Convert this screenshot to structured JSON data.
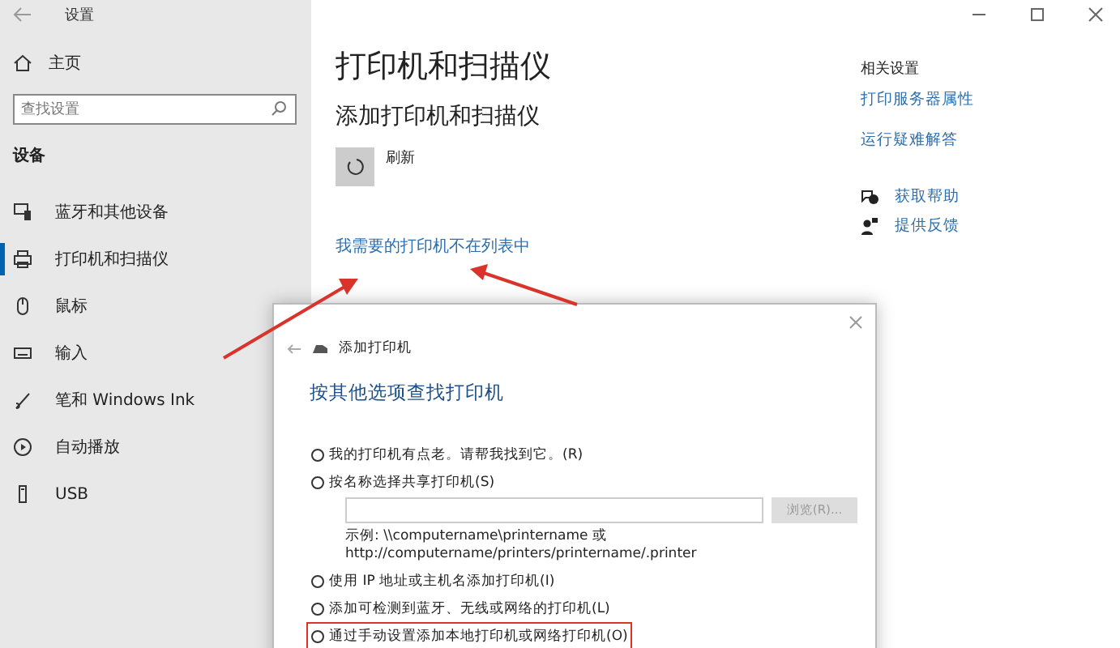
{
  "window": {
    "title": "设置"
  },
  "sidebar": {
    "home": "主页",
    "search": {
      "placeholder": "查找设置"
    },
    "section": "设备",
    "items": [
      {
        "kind": "devices",
        "label": "蓝牙和其他设备",
        "selected": false
      },
      {
        "kind": "printer",
        "label": "打印机和扫描仪",
        "selected": true
      },
      {
        "kind": "mouse",
        "label": "鼠标",
        "selected": false
      },
      {
        "kind": "keyboard",
        "label": "输入",
        "selected": false
      },
      {
        "kind": "pen",
        "label": "笔和 Windows Ink",
        "selected": false
      },
      {
        "kind": "autoplay",
        "label": "自动播放",
        "selected": false
      },
      {
        "kind": "usb",
        "label": "USB",
        "selected": false
      }
    ]
  },
  "main": {
    "title": "打印机和扫描仪",
    "subtitle": "添加打印机和扫描仪",
    "refresh": "刷新",
    "missing_link": "我需要的打印机不在列表中"
  },
  "related": {
    "heading": "相关设置",
    "links": [
      "打印服务器属性",
      "运行疑难解答"
    ],
    "support": [
      {
        "kind": "help",
        "label": "获取帮助"
      },
      {
        "kind": "feedback",
        "label": "提供反馈"
      }
    ]
  },
  "dialog": {
    "title": "添加打印机",
    "heading": "按其他选项查找打印机",
    "options": [
      {
        "label": "我的打印机有点老。请帮我找到它。(R)",
        "selected": false,
        "highlighted": false
      },
      {
        "label": "按名称选择共享打印机(S)",
        "selected": false,
        "highlighted": false,
        "field": {
          "browse": "浏览(R)...",
          "browse_disabled": true,
          "example": [
            "示例: \\\\computername\\printername 或",
            "http://computername/printers/printername/.printer"
          ]
        }
      },
      {
        "label": "使用 IP 地址或主机名添加打印机(I)",
        "selected": false,
        "highlighted": false
      },
      {
        "label": "添加可检测到蓝牙、无线或网络的打印机(L)",
        "selected": false,
        "highlighted": false
      },
      {
        "label": "通过手动设置添加本地打印机或网络打印机(O)",
        "selected": false,
        "highlighted": true
      }
    ]
  }
}
